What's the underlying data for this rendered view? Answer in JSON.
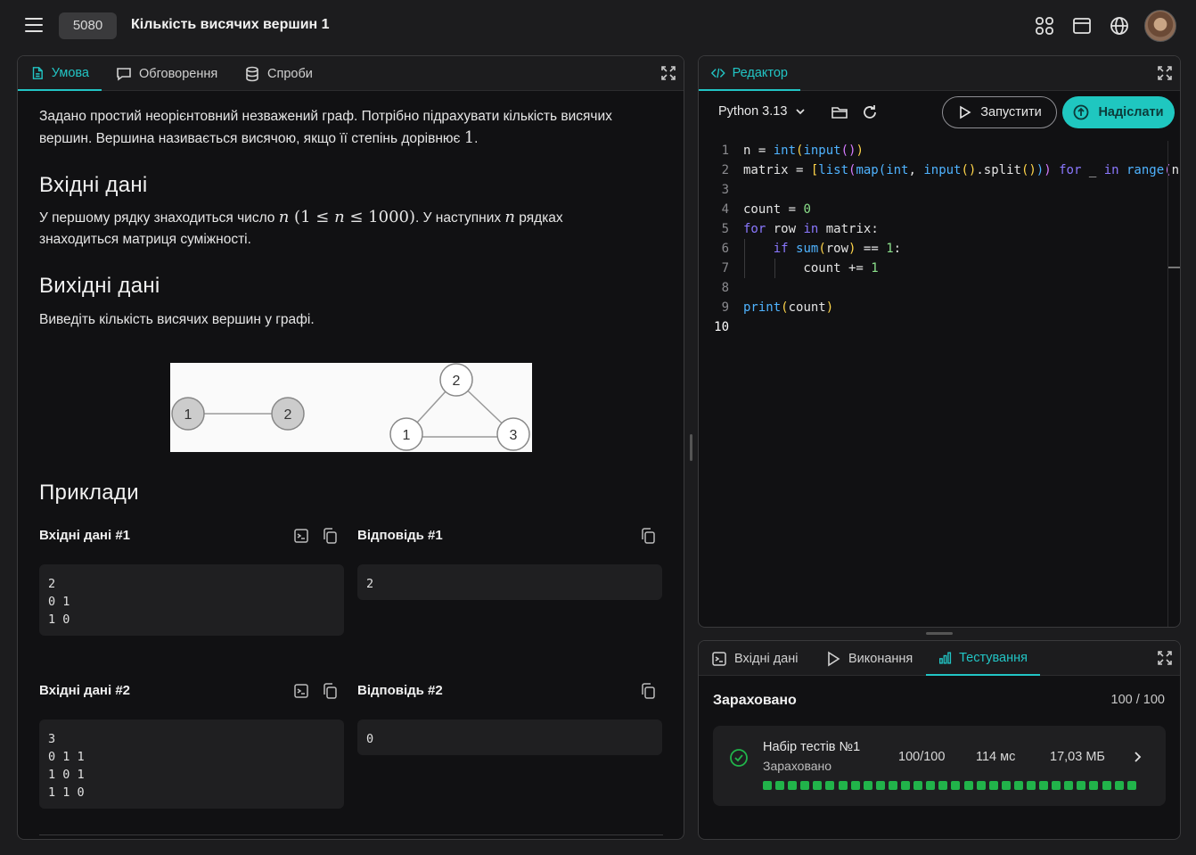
{
  "header": {
    "problem_id": "5080",
    "problem_title": "Кількість висячих вершин 1"
  },
  "left_panel": {
    "tabs": [
      {
        "label": "Умова"
      },
      {
        "label": "Обговорення"
      },
      {
        "label": "Спроби"
      }
    ],
    "statement": {
      "intro_1": "Задано простий неорієнтовний незважений граф. Потрібно підрахувати кількість висячих вершин. Вершина називається висячою, якщо її степінь дорівнює ",
      "intro_num": "1",
      "intro_end": ".",
      "input_heading": "Вхідні дані",
      "input_1": "У першому рядку знаходиться число ",
      "input_var": "n",
      "input_range_open": " (1 ≤ ",
      "input_range_var": "n",
      "input_range_close": " ≤ 1000)",
      "input_2": ". У наступних ",
      "input_3": " рядках знаходиться матриця суміжності.",
      "output_heading": "Вихідні дані",
      "output_text": "Виведіть кількість висячих вершин у графі.",
      "graph_nodes": [
        "1",
        "2",
        "1",
        "2",
        "3"
      ],
      "examples_heading": "Приклади"
    },
    "examples": [
      {
        "input_label": "Вхідні дані #1",
        "input": "2\n0 1\n1 0",
        "answer_label": "Відповідь #1",
        "answer": "2"
      },
      {
        "input_label": "Вхідні дані #2",
        "input": "3\n0 1 1\n1 0 1\n1 1 0",
        "answer_label": "Відповідь #2",
        "answer": "0"
      }
    ]
  },
  "editor": {
    "tab_label": "Редактор",
    "language": "Python 3.13",
    "run_label": "Запустити",
    "submit_label": "Надіслати",
    "line_numbers": [
      "1",
      "2",
      "3",
      "4",
      "5",
      "6",
      "7",
      "8",
      "9",
      "10"
    ]
  },
  "bottom_panel": {
    "tabs": [
      {
        "label": "Вхідні дані"
      },
      {
        "label": "Виконання"
      },
      {
        "label": "Тестування"
      }
    ],
    "status": "Зараховано",
    "score": "100 / 100",
    "test_set": {
      "name": "Набір тестів №1",
      "status": "Зараховано",
      "score": "100/100",
      "time": "114 мс",
      "memory": "17,03 МБ",
      "passed_tests": 30
    }
  },
  "colors": {
    "accent": "#1fc7c0",
    "pass": "#21b34a",
    "background": "#111113"
  }
}
